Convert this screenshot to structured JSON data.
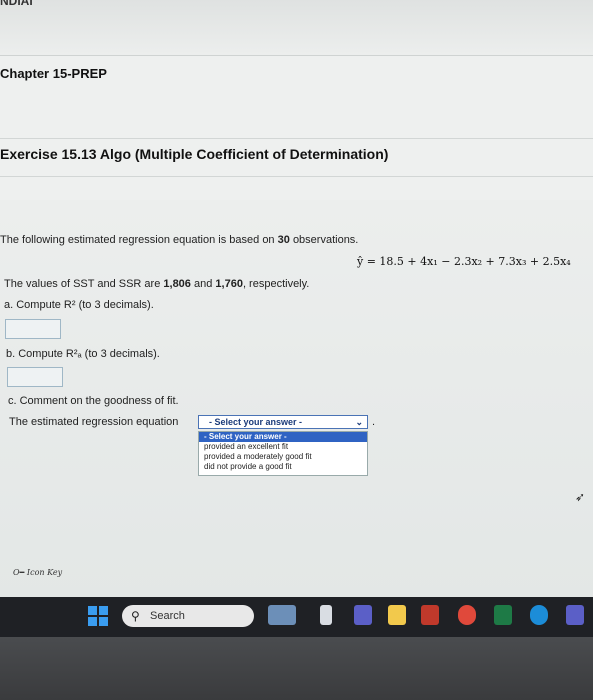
{
  "header": {
    "top_text": "NDIAI",
    "chapter": "Chapter 15-PREP",
    "exercise": "Exercise 15.13 Algo (Multiple Coefficient of Determination)"
  },
  "question": {
    "intro_prefix": "The following estimated regression equation is based on",
    "observations": "30",
    "intro_suffix": "observations.",
    "equation": "ŷ = 18.5 + 4x₁ − 2.3x₂ + 7.3x₃ + 2.5x₄",
    "sst_ssr_prefix": "The values of SST and SSR are",
    "sst": "1,806",
    "and": "and",
    "ssr": "1,760",
    "sst_ssr_suffix": ", respectively.",
    "part_a": "a. Compute R² (to 3 decimals).",
    "part_b": "b. Compute R²ₐ (to 3 decimals).",
    "part_c": "c. Comment on the goodness of fit.",
    "part_c_sentence": "The estimated regression equation",
    "period": "."
  },
  "select": {
    "value": "- Select your answer -",
    "options": [
      "- Select your answer -",
      "provided an excellent fit",
      "provided a moderately good fit",
      "did not provide a good fit"
    ]
  },
  "footer": {
    "icon_key": "Icon Key"
  },
  "taskbar": {
    "search_label": "Search"
  }
}
